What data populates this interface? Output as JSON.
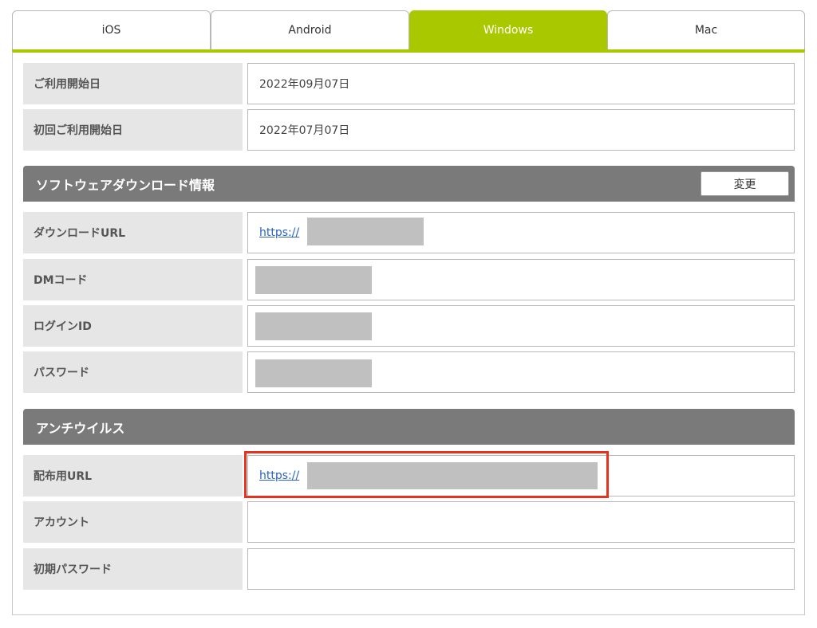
{
  "tabs": [
    {
      "label": "iOS",
      "active": false
    },
    {
      "label": "Android",
      "active": false
    },
    {
      "label": "Windows",
      "active": true
    },
    {
      "label": "Mac",
      "active": false
    }
  ],
  "usage": {
    "start_date_label": "ご利用開始日",
    "start_date_value": "2022年09月07日",
    "first_start_label": "初回ご利用開始日",
    "first_start_value": "2022年07月07日"
  },
  "software_section": {
    "title": "ソフトウェアダウンロード情報",
    "change_button": "変更",
    "download_url_label": "ダウンロードURL",
    "download_url_value": "https://",
    "dm_code_label": "DMコード",
    "login_id_label": "ログインID",
    "password_label": "パスワード"
  },
  "antivirus_section": {
    "title": "アンチウイルス",
    "distribution_url_label": "配布用URL",
    "distribution_url_value": "https://",
    "account_label": "アカウント",
    "initial_password_label": "初期パスワード"
  },
  "colors": {
    "active_tab": "#a9c800",
    "section_header": "#7a7a7a",
    "label_bg": "#e6e6e6",
    "link": "#2a64c4",
    "highlight": "#e8321e",
    "redaction": "#c0c0c0"
  }
}
